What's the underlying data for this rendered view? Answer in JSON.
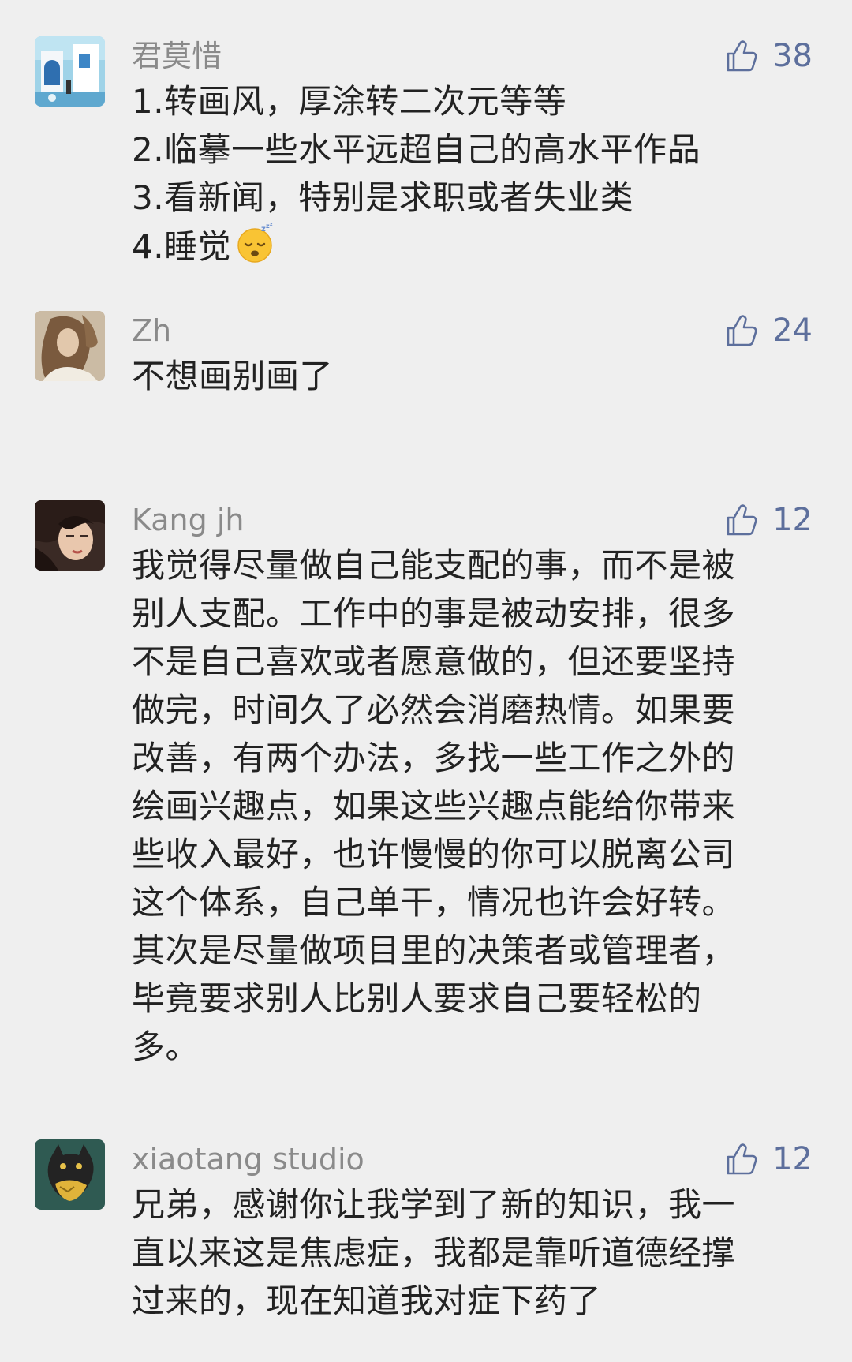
{
  "comments": [
    {
      "name": "君莫惜",
      "likes": "38",
      "lines": [
        "1.转画风，厚涂转二次元等等",
        "2.临摹一些水平远超自己的高水平作品",
        "3.看新闻，特别是求职或者失业类",
        "4.睡觉"
      ],
      "emoji": "sleeping-face-emoji"
    },
    {
      "name": "Zh",
      "likes": "24",
      "lines": [
        "不想画别画了"
      ]
    },
    {
      "name": "Kang jh",
      "likes": "12",
      "lines": [
        "我觉得尽量做自己能支配的事，而不是被",
        "别人支配。工作中的事是被动安排，很多",
        "不是自己喜欢或者愿意做的，但还要坚持",
        "做完，时间久了必然会消磨热情。如果要",
        "改善，有两个办法，多找一些工作之外的",
        "绘画兴趣点，如果这些兴趣点能给你带来",
        "些收入最好，也许慢慢的你可以脱离公司",
        "这个体系，自己单干，情况也许会好转。",
        "其次是尽量做项目里的决策者或管理者，",
        "毕竟要求别人比别人要求自己要轻松的",
        "多。"
      ]
    },
    {
      "name": "xiaotang studio",
      "likes": "12",
      "lines": [
        "兄弟，感谢你让我学到了新的知识，我一",
        "直以来这是焦虑症，我都是靠听道德经撑",
        "过来的，现在知道我对症下药了"
      ]
    }
  ],
  "colors": {
    "background": "#efefef",
    "name": "#8a8a8a",
    "like": "#5d6f9c",
    "text": "#222222"
  },
  "icons": {
    "like": "thumbs-up-icon"
  }
}
